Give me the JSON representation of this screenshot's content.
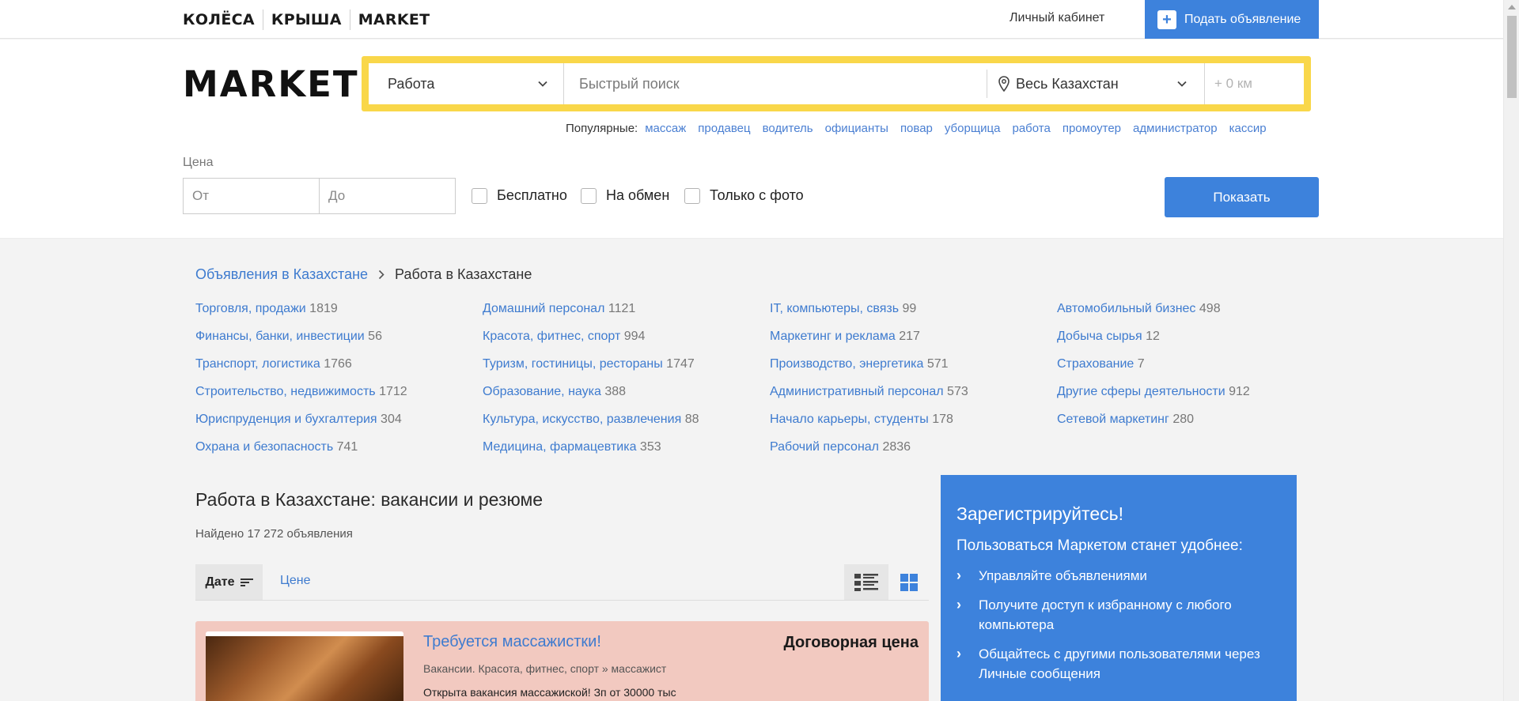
{
  "topbar": {
    "brands": [
      "КОЛЁСА",
      "КРЫША",
      "MARKET"
    ],
    "cabinet_label": "Личный кабинет",
    "post_ad_label": "Подать объявление",
    "post_ad_icon": "plus-icon"
  },
  "search": {
    "logo": "MARKET",
    "category_value": "Работа",
    "query_placeholder": "Быстрый поиск",
    "region_value": "Весь Казахстан",
    "radius_placeholder": "+ 0 км",
    "accent_color": "#f9d74a"
  },
  "popular": {
    "label": "Популярные:",
    "items": [
      "массаж",
      "продавец",
      "водитель",
      "официанты",
      "повар",
      "уборщица",
      "работа",
      "промоутер",
      "администратор",
      "кассир"
    ]
  },
  "filters": {
    "price_label": "Цена",
    "price_from_placeholder": "От",
    "price_to_placeholder": "До",
    "checkbox_free": "Бесплатно",
    "checkbox_exchange": "На обмен",
    "checkbox_photo": "Только с фото",
    "show_button": "Показать"
  },
  "breadcrumb": {
    "parent": "Объявления в Казахстане",
    "current": "Работа в Казахстане"
  },
  "categories": [
    {
      "name": "Торговля, продажи",
      "count": "1819"
    },
    {
      "name": "Домашний персонал",
      "count": "1121"
    },
    {
      "name": "IT, компьютеры, связь",
      "count": "99"
    },
    {
      "name": "Автомобильный бизнес",
      "count": "498"
    },
    {
      "name": "Финансы, банки, инвестиции",
      "count": "56"
    },
    {
      "name": "Красота, фитнес, спорт",
      "count": "994"
    },
    {
      "name": "Маркетинг и реклама",
      "count": "217"
    },
    {
      "name": "Добыча сырья",
      "count": "12"
    },
    {
      "name": "Транспорт, логистика",
      "count": "1766"
    },
    {
      "name": "Туризм, гостиницы, рестораны",
      "count": "1747"
    },
    {
      "name": "Производство, энергетика",
      "count": "571"
    },
    {
      "name": "Страхование",
      "count": "7"
    },
    {
      "name": "Строительство, недвижимость",
      "count": "1712"
    },
    {
      "name": "Образование, наука",
      "count": "388"
    },
    {
      "name": "Административный персонал",
      "count": "573"
    },
    {
      "name": "Другие сферы деятельности",
      "count": "912"
    },
    {
      "name": "Юриспруденция и бухгалтерия",
      "count": "304"
    },
    {
      "name": "Культура, искусство, развлечения",
      "count": "88"
    },
    {
      "name": "Начало карьеры, студенты",
      "count": "178"
    },
    {
      "name": "Сетевой маркетинг",
      "count": "280"
    },
    {
      "name": "Охрана и безопасность",
      "count": "741"
    },
    {
      "name": "Медицина, фармацевтика",
      "count": "353"
    },
    {
      "name": "Рабочий персонал",
      "count": "2836"
    }
  ],
  "listing": {
    "title": "Работа в Казахстане: вакансии и резюме",
    "found": "Найдено 17 272 объявления",
    "sort_date": "Дате",
    "sort_price": "Цене"
  },
  "ads": [
    {
      "title": "Требуется массажистки!",
      "price": "Договорная цена",
      "category": "Вакансии. Красота, фитнес, спорт » массажист",
      "description": "Открыта вакансия массажиской! Зп от 30000 тыс",
      "highlight_color": "#f2c9c0"
    }
  ],
  "register": {
    "title": "Зарегистрируйтесь!",
    "subtitle": "Пользоваться Маркетом станет удобнее:",
    "items": [
      "Управляйте объявлениями",
      "Получите доступ к избранному с любого компьютера",
      "Общайтесь с другими пользователями через Личные сообщения"
    ],
    "bg_color": "#3d82dc"
  }
}
